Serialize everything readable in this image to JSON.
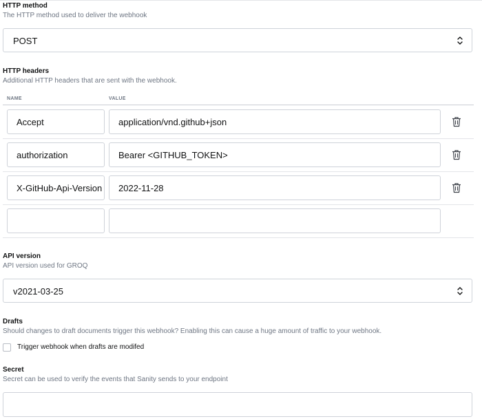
{
  "http_method": {
    "title": "HTTP method",
    "description": "The HTTP method used to deliver the webhook",
    "value": "POST"
  },
  "http_headers": {
    "title": "HTTP headers",
    "description": "Additional HTTP headers that are sent with the webhook.",
    "columns": {
      "name": "NAME",
      "value": "VALUE"
    },
    "rows": [
      {
        "name": "Accept",
        "value": "application/vnd.github+json"
      },
      {
        "name": "authorization",
        "value": "Bearer <GITHUB_TOKEN>"
      },
      {
        "name": "X-GitHub-Api-Version",
        "value": "2022-11-28"
      },
      {
        "name": "",
        "value": ""
      }
    ],
    "delete_icon": "trash-icon"
  },
  "api_version": {
    "title": "API version",
    "description": "API version used for GROQ",
    "value": "v2021-03-25"
  },
  "drafts": {
    "title": "Drafts",
    "description": "Should changes to draft documents trigger this webhook? Enabling this can cause a huge amount of traffic to your webhook.",
    "checkbox_label": "Trigger webhook when drafts are modifed",
    "checked": false
  },
  "secret": {
    "title": "Secret",
    "description": "Secret can be used to verify the events that Sanity sends to your endpoint",
    "value": ""
  }
}
